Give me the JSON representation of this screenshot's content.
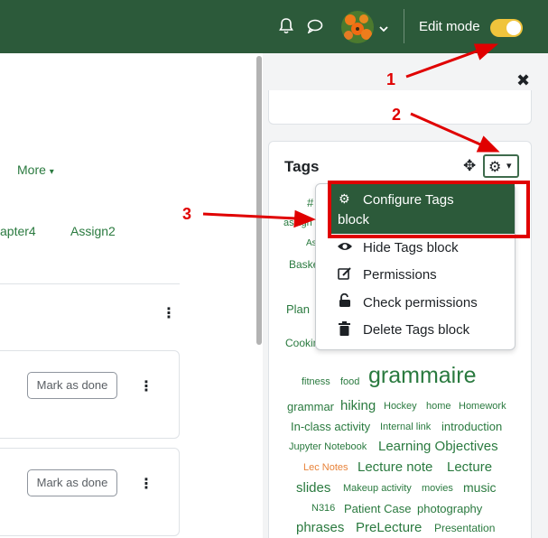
{
  "navbar": {
    "edit_mode_label": "Edit mode",
    "edit_mode_on": true,
    "toggle_color": "#f0c43c",
    "background": "#2c5a3a"
  },
  "course": {
    "more_label": "More",
    "tabs": [
      "apter4",
      "Assign2"
    ],
    "activities": [
      {
        "mark_label": "Mark as done"
      },
      {
        "mark_label": "Mark as done"
      }
    ]
  },
  "tags_block": {
    "title": "Tags",
    "dropdown": [
      {
        "label": "Configure Tags block",
        "icon": "gear-icon"
      },
      {
        "label": "Hide Tags block",
        "icon": "eye-icon"
      },
      {
        "label": "Permissions",
        "icon": "edit-icon"
      },
      {
        "label": "Check permissions",
        "icon": "unlock-icon"
      },
      {
        "label": "Delete Tags block",
        "icon": "trash-icon"
      }
    ],
    "dropdown_line1": "Configure Tags",
    "dropdown_line2": "block",
    "partial_tags": [
      "#",
      "assign",
      "As",
      "Baske",
      "Plan",
      "Cookin"
    ],
    "tags": [
      "fitness",
      "food",
      "grammaire",
      "grammar",
      "hiking",
      "Hockey",
      "home",
      "Homework",
      "In-class activity",
      "Internal link",
      "introduction",
      "Jupyter Notebook",
      "Learning Objectives",
      "Lec Notes",
      "Lecture note",
      "Lecture",
      "slides",
      "Makeup activity",
      "movies",
      "music",
      "N316",
      "Patient Case",
      "photography",
      "phrases",
      "PreLecture",
      "Presentation"
    ]
  },
  "annotations": [
    "1",
    "2",
    "3"
  ],
  "accent_color": "#e00000"
}
